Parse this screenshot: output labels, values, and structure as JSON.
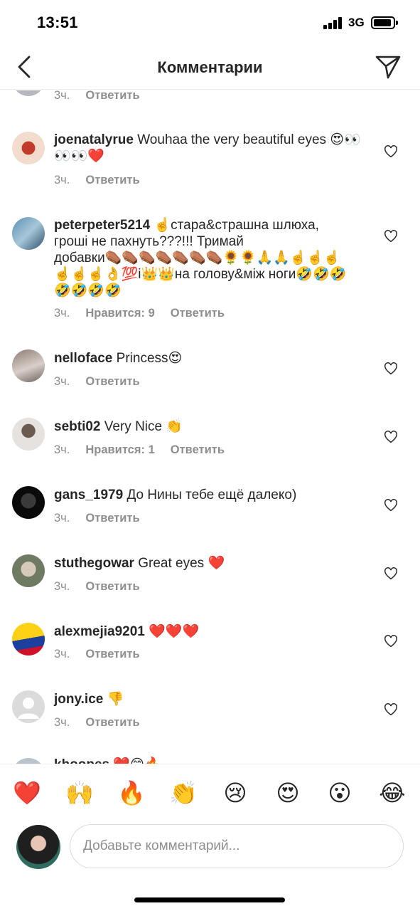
{
  "status": {
    "time": "13:51",
    "network": "3G"
  },
  "header": {
    "title": "Комментарии",
    "back_icon": "chevron-left-icon",
    "send_icon": "paper-plane-icon"
  },
  "comments": [
    {
      "username": "",
      "text": "",
      "time": "3ч.",
      "likes": "",
      "reply": "Ответить"
    },
    {
      "username": "joenatalyrue",
      "text": "Wouhaa the very beautiful eyes 😍👀👀👀❤️",
      "time": "3ч.",
      "likes": "",
      "reply": "Ответить"
    },
    {
      "username": "peterpeter5214",
      "text": "☝️стара&страшна шлюха, гроші не пахнуть???!!! Тримай добавки⚰️⚰️⚰️⚰️⚰️⚰️⚰️🌻🌻🙏🙏☝️☝️☝️☝️☝️☝️👌💯і👑👑на голову&між ноги🤣🤣🤣🤣🤣🤣🤣",
      "time": "3ч.",
      "likes": "Нравится: 9",
      "reply": "Ответить"
    },
    {
      "username": "nelloface",
      "text": "Princess😍",
      "time": "3ч.",
      "likes": "",
      "reply": "Ответить"
    },
    {
      "username": "sebti02",
      "text": "Very Nice 👏",
      "time": "3ч.",
      "likes": "Нравится: 1",
      "reply": "Ответить"
    },
    {
      "username": "gans_1979",
      "text": "До Нины тебе ещё далеко)",
      "time": "3ч.",
      "likes": "",
      "reply": "Ответить"
    },
    {
      "username": "stuthegowar",
      "text": "Great eyes ❤️",
      "time": "3ч.",
      "likes": "",
      "reply": "Ответить"
    },
    {
      "username": "alexmejia9201",
      "text": "❤️❤️❤️",
      "time": "3ч.",
      "likes": "",
      "reply": "Ответить"
    },
    {
      "username": "jony.ice",
      "text": "👎",
      "time": "3ч.",
      "likes": "",
      "reply": "Ответить"
    },
    {
      "username": "khoopes",
      "text": "❤️😊🔥",
      "time": "",
      "likes": "",
      "reply": ""
    }
  ],
  "quick_emojis": [
    "❤️",
    "🙌",
    "🔥",
    "👏",
    "😢",
    "😍",
    "😮",
    "😂"
  ],
  "comment_box": {
    "placeholder": "Добавьте комментарий..."
  },
  "colors": {
    "text": "#262626",
    "secondary": "#8e8e8e",
    "divider": "#efefef",
    "input_border": "#dbdbdb"
  }
}
